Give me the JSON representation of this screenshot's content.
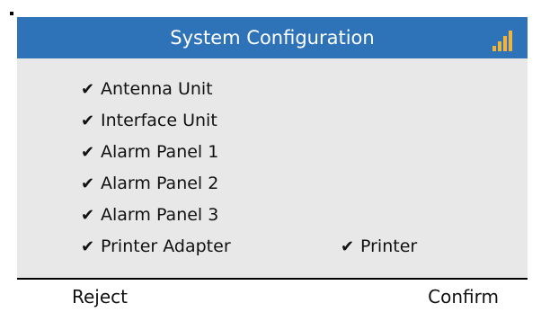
{
  "header": {
    "title": "System Configuration",
    "signal_icon": "signal-bars-icon",
    "signal_color": "#f0b43a",
    "background_color": "#2e73b8"
  },
  "items": [
    {
      "label": "Antenna Unit",
      "checked": true
    },
    {
      "label": "Interface Unit",
      "checked": true
    },
    {
      "label": "Alarm Panel 1",
      "checked": true
    },
    {
      "label": "Alarm Panel 2",
      "checked": true
    },
    {
      "label": "Alarm Panel 3",
      "checked": true
    },
    {
      "label": "Printer Adapter",
      "checked": true
    }
  ],
  "items_right": [
    {
      "label": "Printer",
      "checked": true
    }
  ],
  "check_glyph": "✔",
  "softkeys": {
    "left": "Reject",
    "right": "Confirm"
  }
}
